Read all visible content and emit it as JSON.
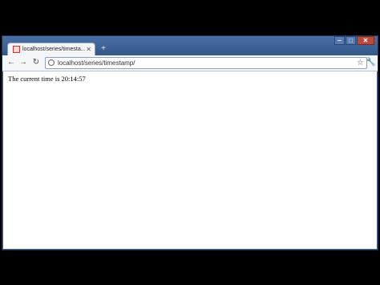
{
  "browser": {
    "tab": {
      "title": "localhost/series/timesta..."
    },
    "address_bar": {
      "url": "localhost/series/timestamp/"
    },
    "icons": {
      "favicon": "page-favicon-icon",
      "close_tab": "close-icon",
      "new_tab": "plus-icon",
      "back": "back-arrow-icon",
      "forward": "forward-arrow-icon",
      "reload": "reload-icon",
      "globe": "globe-icon",
      "star": "star-icon",
      "wrench": "wrench-icon"
    },
    "colors": {
      "frame": "#3d5e8f",
      "toolbar": "#f4f6f9"
    }
  },
  "page": {
    "text": "The current time is 20:14:57"
  }
}
